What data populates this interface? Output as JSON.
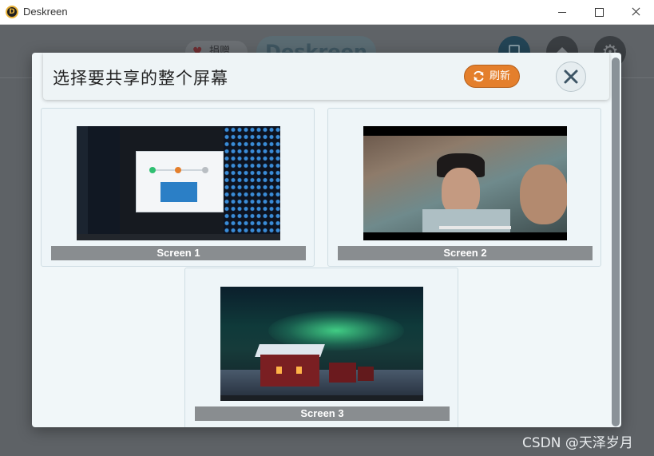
{
  "window": {
    "title": "Deskreen",
    "logo_letter": "D"
  },
  "background": {
    "donate_label": "捐赠",
    "brand_text": "Deskreen",
    "icons": [
      "screen-icon",
      "graduation-icon",
      "gear-icon"
    ]
  },
  "dialog": {
    "title": "选择要共享的整个屏幕",
    "refresh_label": "刷新",
    "screens": [
      {
        "label": "Screen 1"
      },
      {
        "label": "Screen 2"
      },
      {
        "label": "Screen 3"
      }
    ]
  },
  "watermark": "CSDN @天泽岁月",
  "colors": {
    "accent_orange": "#e47f2c",
    "label_gray": "#898d90",
    "modal_bg": "#f1f7f9"
  }
}
